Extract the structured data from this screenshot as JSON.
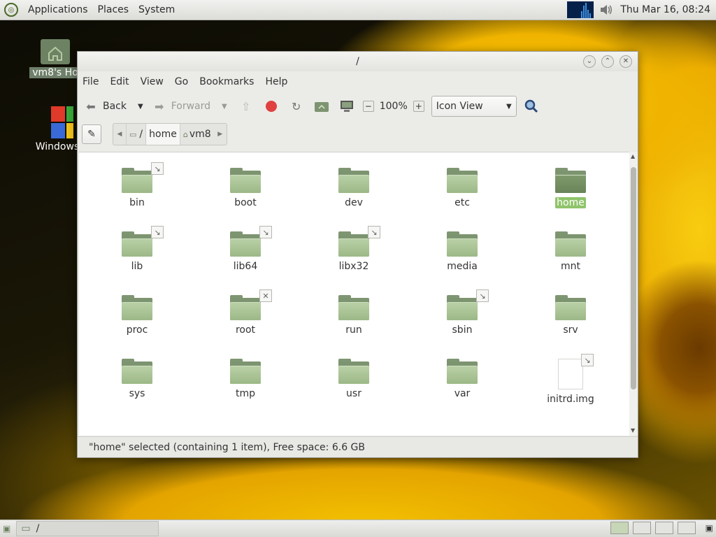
{
  "top_panel": {
    "menu": [
      "Applications",
      "Places",
      "System"
    ],
    "clock": "Thu Mar 16, 08:24"
  },
  "desktop": {
    "icons": [
      {
        "label": "vm8's Ho",
        "icon": "home-folder-icon"
      },
      {
        "label": "Windows",
        "icon": "windows-logo-icon"
      }
    ]
  },
  "window": {
    "title": "/",
    "menubar": [
      "File",
      "Edit",
      "View",
      "Go",
      "Bookmarks",
      "Help"
    ],
    "toolbar": {
      "back": "Back",
      "forward": "Forward",
      "zoom": "100%",
      "view_mode": "Icon View"
    },
    "path": {
      "root": "/",
      "home": "home",
      "user": "vm8"
    },
    "items": [
      {
        "name": "bin",
        "type": "folder",
        "emblem": "link",
        "selected": false
      },
      {
        "name": "boot",
        "type": "folder",
        "emblem": "",
        "selected": false
      },
      {
        "name": "dev",
        "type": "folder",
        "emblem": "",
        "selected": false
      },
      {
        "name": "etc",
        "type": "folder",
        "emblem": "",
        "selected": false
      },
      {
        "name": "home",
        "type": "folder",
        "emblem": "",
        "selected": true
      },
      {
        "name": "lib",
        "type": "folder",
        "emblem": "link",
        "selected": false
      },
      {
        "name": "lib64",
        "type": "folder",
        "emblem": "link",
        "selected": false
      },
      {
        "name": "libx32",
        "type": "folder",
        "emblem": "link",
        "selected": false
      },
      {
        "name": "media",
        "type": "folder",
        "emblem": "",
        "selected": false
      },
      {
        "name": "mnt",
        "type": "folder",
        "emblem": "",
        "selected": false
      },
      {
        "name": "proc",
        "type": "folder",
        "emblem": "",
        "selected": false
      },
      {
        "name": "root",
        "type": "folder",
        "emblem": "locked",
        "selected": false
      },
      {
        "name": "run",
        "type": "folder",
        "emblem": "",
        "selected": false
      },
      {
        "name": "sbin",
        "type": "folder",
        "emblem": "link",
        "selected": false
      },
      {
        "name": "srv",
        "type": "folder",
        "emblem": "",
        "selected": false
      },
      {
        "name": "sys",
        "type": "folder",
        "emblem": "",
        "selected": false
      },
      {
        "name": "tmp",
        "type": "folder",
        "emblem": "",
        "selected": false
      },
      {
        "name": "usr",
        "type": "folder",
        "emblem": "",
        "selected": false
      },
      {
        "name": "var",
        "type": "folder",
        "emblem": "",
        "selected": false
      },
      {
        "name": "initrd.img",
        "type": "file",
        "emblem": "link",
        "selected": false
      }
    ],
    "status": "\"home\" selected (containing 1 item), Free space: 6.6 GB"
  },
  "bottom_panel": {
    "task_label": "/"
  },
  "colors": {
    "selection": "#8fc46a",
    "folder_front": "#a9c394",
    "folder_back": "#7d9470",
    "panel": "#e4e4e0"
  }
}
